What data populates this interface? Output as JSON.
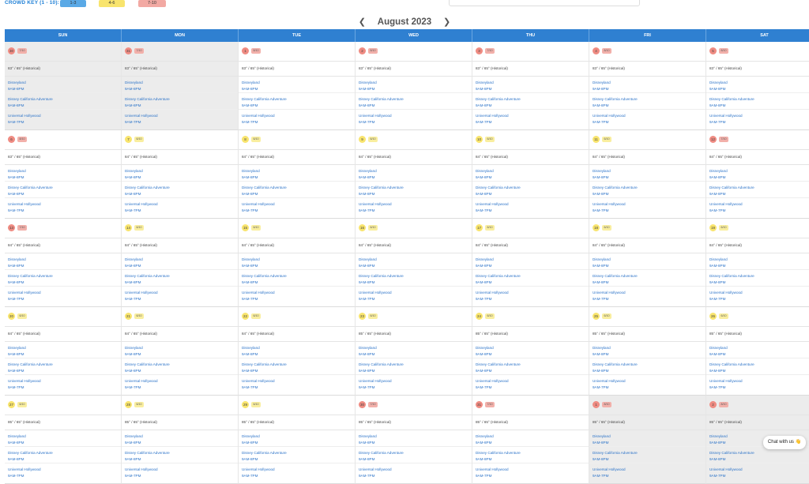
{
  "crowd_key": {
    "label": "CROWD KEY (1 - 10):",
    "levels": [
      {
        "label": "1-3",
        "color": "#5aa9e6"
      },
      {
        "label": "4-6",
        "color": "#f8e46d"
      },
      {
        "label": "7-10",
        "color": "#f2a9a3"
      }
    ]
  },
  "month": {
    "title": "August 2023",
    "prev_icon": "chevron-left-icon",
    "next_icon": "chevron-right-icon"
  },
  "weekdays": [
    "SUN",
    "MON",
    "TUE",
    "WED",
    "THU",
    "FRI",
    "SAT"
  ],
  "parks": {
    "disneyland": "Disneyland",
    "dca": "Disney California Adventure",
    "universal": "Universal Hollywood",
    "hours_dl": "9AM-8PM",
    "hours_dca": "9AM-8PM",
    "hours_uh": "9AM-7PM"
  },
  "weeks": [
    [
      {
        "day": "30",
        "crowd": "7/10",
        "level": "high",
        "temp": "83° / 65° (Historical)",
        "muted": true
      },
      {
        "day": "31",
        "crowd": "7/10",
        "level": "high",
        "temp": "83° / 65° (Historical)",
        "muted": true
      },
      {
        "day": "1",
        "crowd": "8/10",
        "level": "high",
        "temp": "83° / 65° (Historical)",
        "muted": false
      },
      {
        "day": "2",
        "crowd": "8/10",
        "level": "high",
        "temp": "83° / 65° (Historical)",
        "muted": false
      },
      {
        "day": "3",
        "crowd": "7/10",
        "level": "high",
        "temp": "83° / 65° (Historical)",
        "muted": false
      },
      {
        "day": "4",
        "crowd": "8/10",
        "level": "high",
        "temp": "83° / 65° (Historical)",
        "muted": false
      },
      {
        "day": "5",
        "crowd": "8/10",
        "level": "high",
        "temp": "83° / 65° (Historical)",
        "muted": false
      }
    ],
    [
      {
        "day": "6",
        "crowd": "8/10",
        "level": "high",
        "temp": "83° / 65° (Historical)",
        "muted": false
      },
      {
        "day": "7",
        "crowd": "6/10",
        "level": "mid",
        "temp": "84° / 65° (Historical)",
        "muted": false
      },
      {
        "day": "8",
        "crowd": "6/10",
        "level": "mid",
        "temp": "84° / 65° (Historical)",
        "muted": false
      },
      {
        "day": "9",
        "crowd": "6/10",
        "level": "mid",
        "temp": "84° / 65° (Historical)",
        "muted": false
      },
      {
        "day": "10",
        "crowd": "6/10",
        "level": "mid",
        "temp": "84° / 65° (Historical)",
        "muted": false
      },
      {
        "day": "11",
        "crowd": "6/10",
        "level": "mid",
        "temp": "84° / 65° (Historical)",
        "muted": false
      },
      {
        "day": "12",
        "crowd": "7/10",
        "level": "high",
        "temp": "84° / 65° (Historical)",
        "muted": false
      }
    ],
    [
      {
        "day": "13",
        "crowd": "7/10",
        "level": "high",
        "temp": "84° / 65° (Historical)",
        "muted": false
      },
      {
        "day": "14",
        "crowd": "6/10",
        "level": "mid",
        "temp": "84° / 65° (Historical)",
        "muted": false
      },
      {
        "day": "15",
        "crowd": "6/10",
        "level": "mid",
        "temp": "84° / 65° (Historical)",
        "muted": false
      },
      {
        "day": "16",
        "crowd": "6/10",
        "level": "mid",
        "temp": "84° / 65° (Historical)",
        "muted": false
      },
      {
        "day": "17",
        "crowd": "6/10",
        "level": "mid",
        "temp": "84° / 65° (Historical)",
        "muted": false
      },
      {
        "day": "18",
        "crowd": "6/10",
        "level": "mid",
        "temp": "84° / 65° (Historical)",
        "muted": false
      },
      {
        "day": "19",
        "crowd": "6/10",
        "level": "mid",
        "temp": "84° / 65° (Historical)",
        "muted": false
      }
    ],
    [
      {
        "day": "20",
        "crowd": "6/10",
        "level": "mid",
        "temp": "84° / 65° (Historical)",
        "muted": false
      },
      {
        "day": "21",
        "crowd": "6/10",
        "level": "mid",
        "temp": "84° / 65° (Historical)",
        "muted": false
      },
      {
        "day": "22",
        "crowd": "6/10",
        "level": "mid",
        "temp": "84° / 65° (Historical)",
        "muted": false
      },
      {
        "day": "23",
        "crowd": "6/10",
        "level": "mid",
        "temp": "85° / 65° (Historical)",
        "muted": false
      },
      {
        "day": "24",
        "crowd": "6/10",
        "level": "mid",
        "temp": "85° / 65° (Historical)",
        "muted": false
      },
      {
        "day": "25",
        "crowd": "6/10",
        "level": "mid",
        "temp": "85° / 65° (Historical)",
        "muted": false
      },
      {
        "day": "26",
        "crowd": "6/10",
        "level": "mid",
        "temp": "85° / 65° (Historical)",
        "muted": false
      }
    ],
    [
      {
        "day": "27",
        "crowd": "6/10",
        "level": "mid",
        "temp": "85° / 65° (Historical)",
        "muted": false
      },
      {
        "day": "28",
        "crowd": "6/10",
        "level": "mid",
        "temp": "85° / 65° (Historical)",
        "muted": false
      },
      {
        "day": "29",
        "crowd": "6/10",
        "level": "mid",
        "temp": "85° / 65° (Historical)",
        "muted": false
      },
      {
        "day": "30",
        "crowd": "7/10",
        "level": "high",
        "temp": "85° / 65° (Historical)",
        "muted": false
      },
      {
        "day": "31",
        "crowd": "7/10",
        "level": "high",
        "temp": "85° / 65° (Historical)",
        "muted": false
      },
      {
        "day": "1",
        "crowd": "8/10",
        "level": "high",
        "temp": "85° / 65° (Historical)",
        "muted": true
      },
      {
        "day": "2",
        "crowd": "8/10",
        "level": "high",
        "temp": "85° / 65° (Historical)",
        "muted": true
      }
    ]
  ],
  "chat": {
    "label": "Chat with us",
    "emoji": "👋"
  }
}
